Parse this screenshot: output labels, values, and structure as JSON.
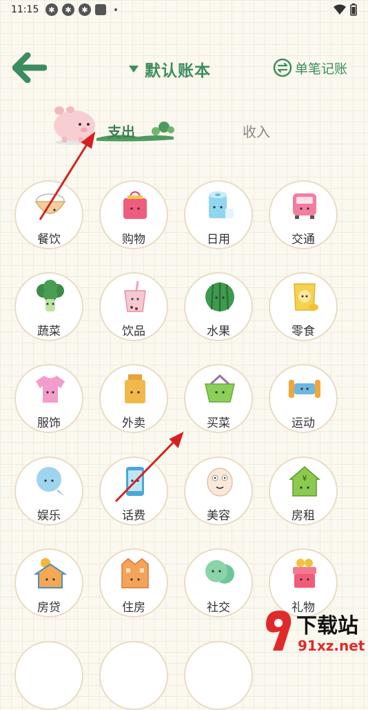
{
  "status_bar": {
    "time": "11:15"
  },
  "header": {
    "book_title": "默认账本",
    "single_label": "单笔记账"
  },
  "tabs": {
    "expense": "支出",
    "income": "收入"
  },
  "categories": [
    {
      "label": "餐饮",
      "icon": "rice-bowl-icon"
    },
    {
      "label": "购物",
      "icon": "shopping-bag-icon"
    },
    {
      "label": "日用",
      "icon": "tissue-roll-icon"
    },
    {
      "label": "交通",
      "icon": "bus-icon"
    },
    {
      "label": "蔬菜",
      "icon": "broccoli-icon"
    },
    {
      "label": "饮品",
      "icon": "bubble-tea-icon"
    },
    {
      "label": "水果",
      "icon": "watermelon-icon"
    },
    {
      "label": "零食",
      "icon": "chips-icon"
    },
    {
      "label": "服饰",
      "icon": "tshirt-icon"
    },
    {
      "label": "外卖",
      "icon": "takeout-box-icon"
    },
    {
      "label": "买菜",
      "icon": "basket-icon"
    },
    {
      "label": "运动",
      "icon": "dumbbell-icon"
    },
    {
      "label": "娱乐",
      "icon": "chat-bubble-icon"
    },
    {
      "label": "话费",
      "icon": "phone-icon"
    },
    {
      "label": "美容",
      "icon": "face-mask-icon"
    },
    {
      "label": "房租",
      "icon": "house-icon"
    },
    {
      "label": "房贷",
      "icon": "house-loan-icon"
    },
    {
      "label": "住房",
      "icon": "building-icon"
    },
    {
      "label": "社交",
      "icon": "social-icon"
    },
    {
      "label": "礼物",
      "icon": "gift-icon"
    }
  ],
  "watermark": {
    "text": "下载站",
    "domain": "91xz.net"
  },
  "colors": {
    "accent": "#3c8d5e",
    "circle_border": "#e8dcc4",
    "annotation_arrow": "#d62020"
  }
}
